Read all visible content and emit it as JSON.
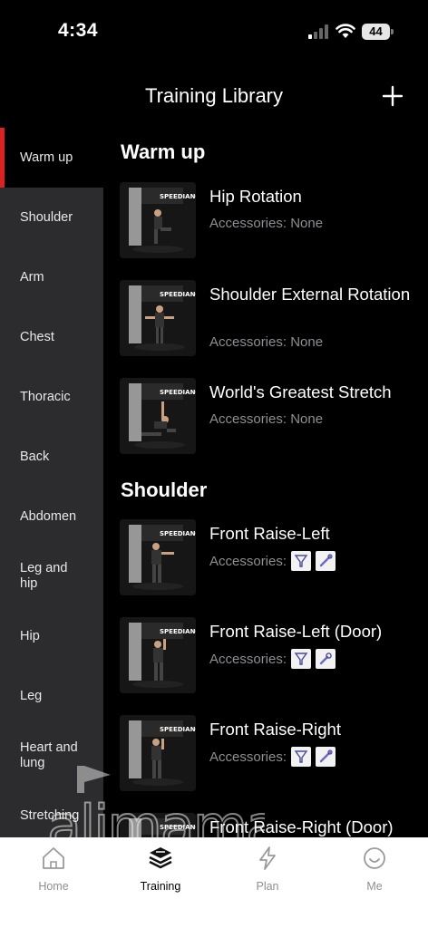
{
  "status_bar": {
    "time": "4:34",
    "battery": "44"
  },
  "header": {
    "title": "Training Library"
  },
  "sidebar": {
    "items": [
      {
        "label": "Warm up",
        "active": true
      },
      {
        "label": "Shoulder"
      },
      {
        "label": "Arm"
      },
      {
        "label": "Chest"
      },
      {
        "label": "Thoracic"
      },
      {
        "label": "Back"
      },
      {
        "label": "Abdomen"
      },
      {
        "label": "Leg and hip"
      },
      {
        "label": "Hip"
      },
      {
        "label": "Leg"
      },
      {
        "label": "Heart and lung"
      },
      {
        "label": "Stretching"
      }
    ]
  },
  "sections": [
    {
      "title": "Warm up",
      "exercises": [
        {
          "name": "Hip Rotation",
          "accessories_label": "Accessories: None"
        },
        {
          "name": "Shoulder External Rotation",
          "accessories_label": "Accessories: None"
        },
        {
          "name": "World's Greatest Stretch",
          "accessories_label": "Accessories: None"
        }
      ]
    },
    {
      "title": "Shoulder",
      "exercises": [
        {
          "name": "Front Raise-Left",
          "accessories_label": "Accessories:",
          "accessory_icons": [
            "handle-icon",
            "strap-icon"
          ]
        },
        {
          "name": "Front Raise-Left (Door)",
          "accessories_label": "Accessories:",
          "accessory_icons": [
            "handle-icon",
            "door-anchor-icon"
          ]
        },
        {
          "name": "Front Raise-Right",
          "accessories_label": "Accessories:",
          "accessory_icons": [
            "handle-icon",
            "strap-icon"
          ]
        },
        {
          "name": "Front Raise-Right (Door)"
        }
      ]
    }
  ],
  "tab_bar": {
    "tabs": [
      {
        "label": "Home",
        "icon": "home-icon"
      },
      {
        "label": "Training",
        "icon": "training-icon",
        "active": true
      },
      {
        "label": "Plan",
        "icon": "lightning-icon"
      },
      {
        "label": "Me",
        "icon": "smiley-icon"
      }
    ]
  },
  "watermark": "alimama.in",
  "colors": {
    "accent": "#e02020",
    "sidebar_bg": "#2c2c2e",
    "muted_text": "#8e8e93"
  }
}
